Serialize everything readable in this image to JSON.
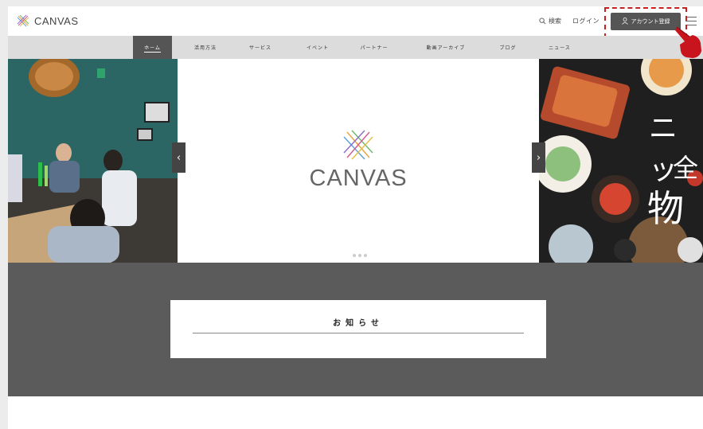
{
  "header": {
    "logo_text": "CANVAS",
    "search_label": "検索",
    "login_label": "ログイン",
    "account_label": "アカウント登録"
  },
  "nav": {
    "items": [
      {
        "label": "ホーム",
        "active": true
      },
      {
        "label": "活用方法"
      },
      {
        "label": "サービス"
      },
      {
        "label": "イベント"
      },
      {
        "label": "パートナー"
      },
      {
        "label": "動画アーカイブ"
      },
      {
        "label": "ブログ"
      },
      {
        "label": "ニュース"
      }
    ]
  },
  "hero": {
    "brand_text": "CANVAS",
    "prev_arrow": "‹",
    "next_arrow": "›",
    "right_slide_text": [
      "ニッ",
      "全",
      "物"
    ],
    "dots_count": 3
  },
  "notices": {
    "title": "お知らせ"
  },
  "colors": {
    "header_bg": "#ffffff",
    "nav_bg": "#dcdcdc",
    "nav_active": "#555555",
    "account_button": "#555555",
    "highlight_dash": "#c62020",
    "band_bg": "#5b5b5b"
  }
}
